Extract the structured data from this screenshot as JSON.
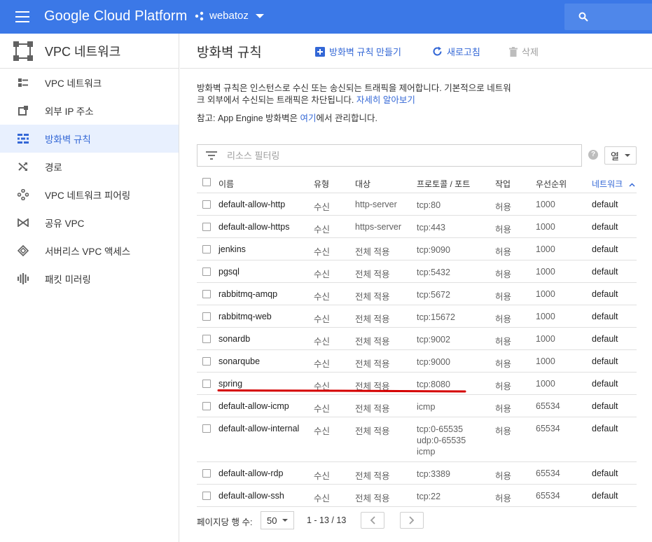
{
  "topbar": {
    "brand": "Google Cloud Platform",
    "project": "webatoz"
  },
  "sidebar": {
    "title": "VPC 네트워크",
    "items": [
      {
        "label": "VPC 네트워크",
        "icon": "vpc-networks-icon",
        "active": false
      },
      {
        "label": "외부 IP 주소",
        "icon": "external-ip-icon",
        "active": false
      },
      {
        "label": "방화벽 규칙",
        "icon": "firewall-icon",
        "active": true
      },
      {
        "label": "경로",
        "icon": "routes-icon",
        "active": false
      },
      {
        "label": "VPC 네트워크 피어링",
        "icon": "peering-icon",
        "active": false
      },
      {
        "label": "공유 VPC",
        "icon": "shared-vpc-icon",
        "active": false
      },
      {
        "label": "서버리스 VPC 액세스",
        "icon": "serverless-icon",
        "active": false
      },
      {
        "label": "패킷 미러링",
        "icon": "packet-mirroring-icon",
        "active": false
      }
    ]
  },
  "header": {
    "title": "방화벽 규칙",
    "create_label": "방화벽 규칙 만들기",
    "refresh_label": "새로고침",
    "delete_label": "삭제"
  },
  "description": {
    "text": "방화벽 규칙은 인스턴스로 수신 또는 송신되는 트래픽을 제어합니다. 기본적으로 네트워크 외부에서 수신되는 트래픽은 차단됩니다. ",
    "learn_more": "자세히 알아보기",
    "note_prefix": "참고: App Engine 방화벽은 ",
    "note_link": "여기",
    "note_suffix": "에서 관리합니다."
  },
  "filter": {
    "placeholder": "리소스 필터링",
    "columns_label": "열",
    "help": "?"
  },
  "table": {
    "headers": {
      "name": "이름",
      "type": "유형",
      "target": "대상",
      "proto": "프로토콜 / 포트",
      "action": "작업",
      "priority": "우선순위",
      "network": "네트워크",
      "sort_arrow": "^"
    },
    "rows": [
      {
        "name": "default-allow-http",
        "type": "수신",
        "target": "http-server",
        "proto": [
          "tcp:80"
        ],
        "action": "허용",
        "priority": "1000",
        "network": "default"
      },
      {
        "name": "default-allow-https",
        "type": "수신",
        "target": "https-server",
        "proto": [
          "tcp:443"
        ],
        "action": "허용",
        "priority": "1000",
        "network": "default"
      },
      {
        "name": "jenkins",
        "type": "수신",
        "target": "전체 적용",
        "proto": [
          "tcp:9090"
        ],
        "action": "허용",
        "priority": "1000",
        "network": "default"
      },
      {
        "name": "pgsql",
        "type": "수신",
        "target": "전체 적용",
        "proto": [
          "tcp:5432"
        ],
        "action": "허용",
        "priority": "1000",
        "network": "default"
      },
      {
        "name": "rabbitmq-amqp",
        "type": "수신",
        "target": "전체 적용",
        "proto": [
          "tcp:5672"
        ],
        "action": "허용",
        "priority": "1000",
        "network": "default"
      },
      {
        "name": "rabbitmq-web",
        "type": "수신",
        "target": "전체 적용",
        "proto": [
          "tcp:15672"
        ],
        "action": "허용",
        "priority": "1000",
        "network": "default"
      },
      {
        "name": "sonardb",
        "type": "수신",
        "target": "전체 적용",
        "proto": [
          "tcp:9002"
        ],
        "action": "허용",
        "priority": "1000",
        "network": "default"
      },
      {
        "name": "sonarqube",
        "type": "수신",
        "target": "전체 적용",
        "proto": [
          "tcp:9000"
        ],
        "action": "허용",
        "priority": "1000",
        "network": "default"
      },
      {
        "name": "spring",
        "type": "수신",
        "target": "전체 적용",
        "proto": [
          "tcp:8080"
        ],
        "action": "허용",
        "priority": "1000",
        "network": "default"
      },
      {
        "name": "default-allow-icmp",
        "type": "수신",
        "target": "전체 적용",
        "proto": [
          "icmp"
        ],
        "action": "허용",
        "priority": "65534",
        "network": "default"
      },
      {
        "name": "default-allow-internal",
        "type": "수신",
        "target": "전체 적용",
        "proto": [
          "tcp:0-65535",
          "udp:0-65535",
          "icmp"
        ],
        "action": "허용",
        "priority": "65534",
        "network": "default"
      },
      {
        "name": "default-allow-rdp",
        "type": "수신",
        "target": "전체 적용",
        "proto": [
          "tcp:3389"
        ],
        "action": "허용",
        "priority": "65534",
        "network": "default"
      },
      {
        "name": "default-allow-ssh",
        "type": "수신",
        "target": "전체 적용",
        "proto": [
          "tcp:22"
        ],
        "action": "허용",
        "priority": "65534",
        "network": "default"
      }
    ]
  },
  "pagination": {
    "per_page_label": "페이지당 행 수:",
    "per_page_value": "50",
    "range": "1 - 13 / 13"
  },
  "colors": {
    "topbar": "#3b78e7",
    "accent": "#3367d6",
    "active_bg": "#e8f0fe",
    "annotation": "#d50000"
  }
}
